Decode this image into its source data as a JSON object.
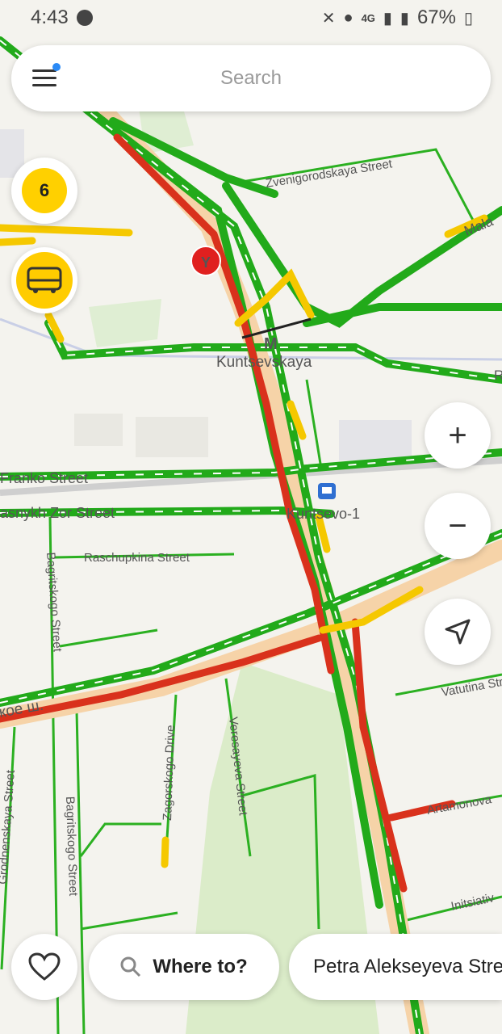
{
  "status_bar": {
    "time": "4:43",
    "battery": "67%",
    "network": "4G"
  },
  "search": {
    "placeholder": "Search"
  },
  "traffic": {
    "score": "6"
  },
  "map": {
    "streets": {
      "zvenigorodskaya": "Zvenigorodskaya Street",
      "malaya": "Mala",
      "franko": "Franko Street",
      "krasnykh_zor": "asnykh Zor Street",
      "raschupkina": "Raschupkina Street",
      "bagritskogo_1": "Bagritskogo Street",
      "bagritskogo_2": "Bagritskogo Street",
      "grodnenskaya": "Grodnenskaya Street",
      "zagorskogo": "Zagorskogo Drive",
      "veresayeva": "Veresayeva Street",
      "vatutina": "Vatutina Street",
      "artamonova": "Artamonova",
      "initsiativ": "Initsiativ",
      "shosse": "кое ш."
    },
    "stations": {
      "metro": "Kuntsevskaya",
      "metro_glyph": "M",
      "rail": "Kuntsevo-1",
      "marker_letter": "Y",
      "r_edge": "R"
    },
    "colors": {
      "free": "#22aa1a",
      "slow": "#f5c800",
      "jam": "#d9311c",
      "highway": "#f6d3a8"
    }
  },
  "controls": {
    "zoom_in": "+",
    "zoom_out": "−"
  },
  "bottom": {
    "where_to": "Where to?",
    "suggestion": "Petra Alekseyeva Stre"
  }
}
